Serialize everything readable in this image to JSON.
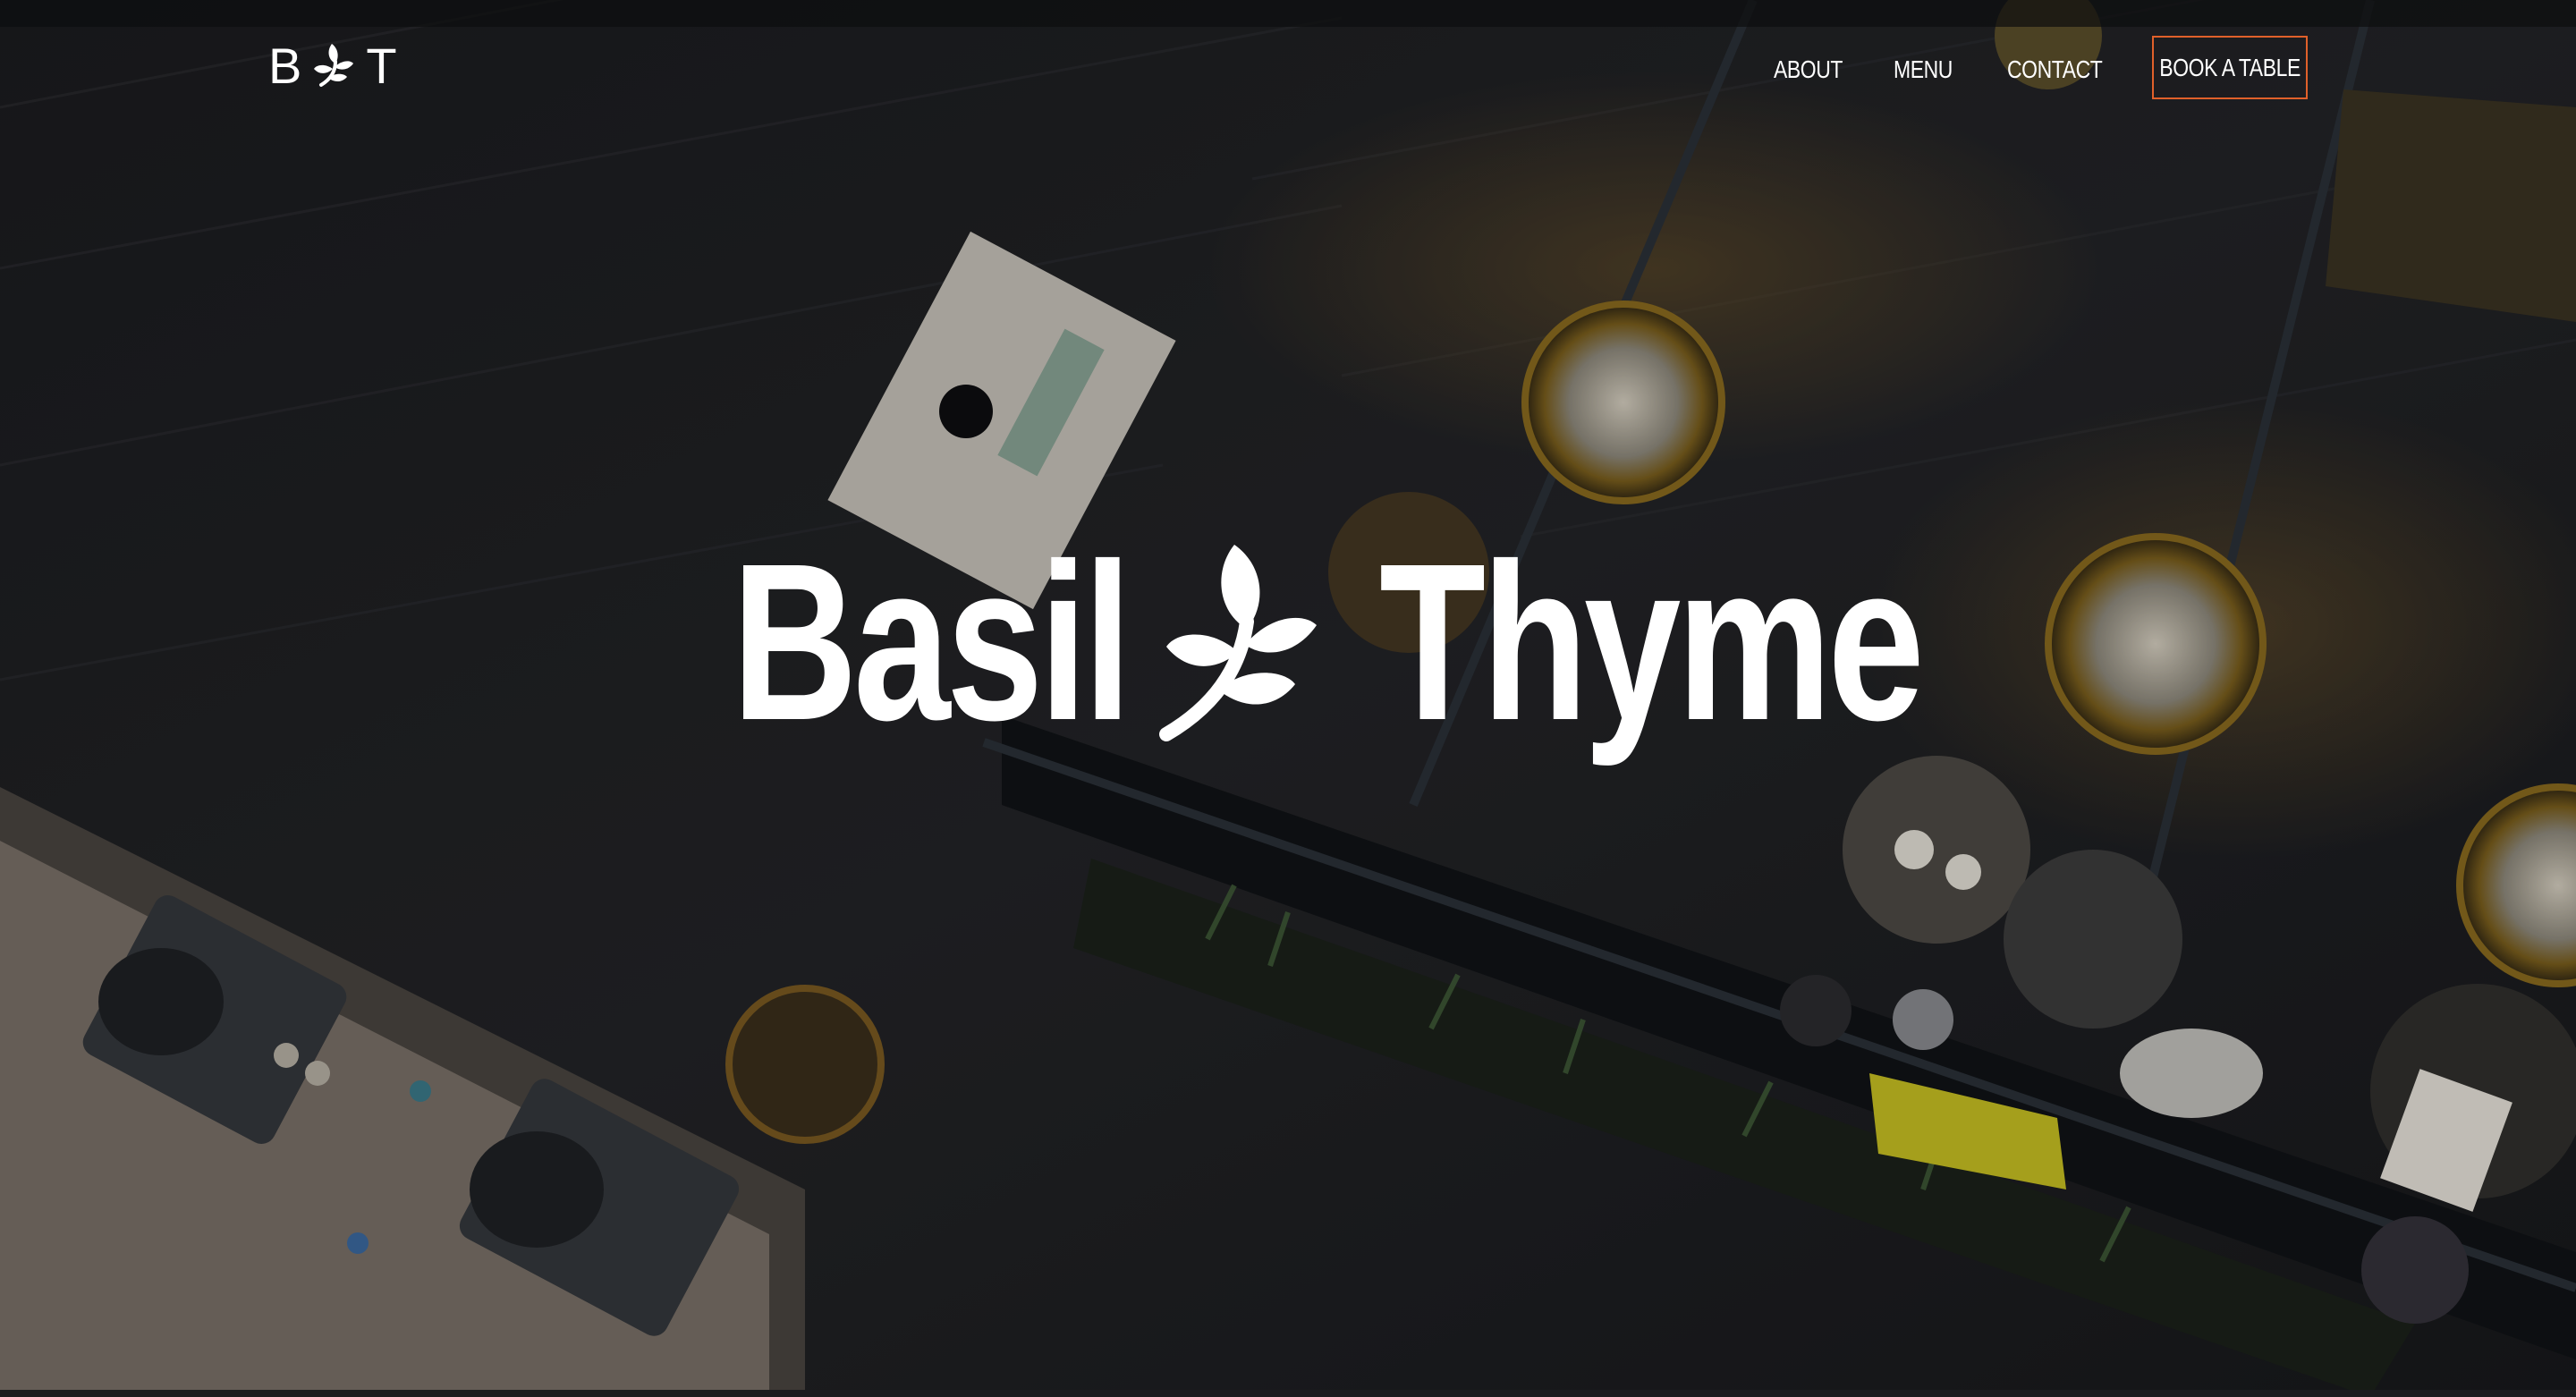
{
  "logo": {
    "left_letter": "B",
    "right_letter": "T",
    "icon": "basil-leaf-icon"
  },
  "nav": {
    "about": "ABOUT",
    "menu": "MENU",
    "contact": "CONTACT",
    "cta": "BOOK A TABLE"
  },
  "hero": {
    "title_first": "Basil",
    "title_second": "Thyme",
    "icon": "basil-leaf-icon"
  },
  "colors": {
    "cta_border": "#e0602a",
    "text": "#ffffff",
    "background": "#121417"
  }
}
